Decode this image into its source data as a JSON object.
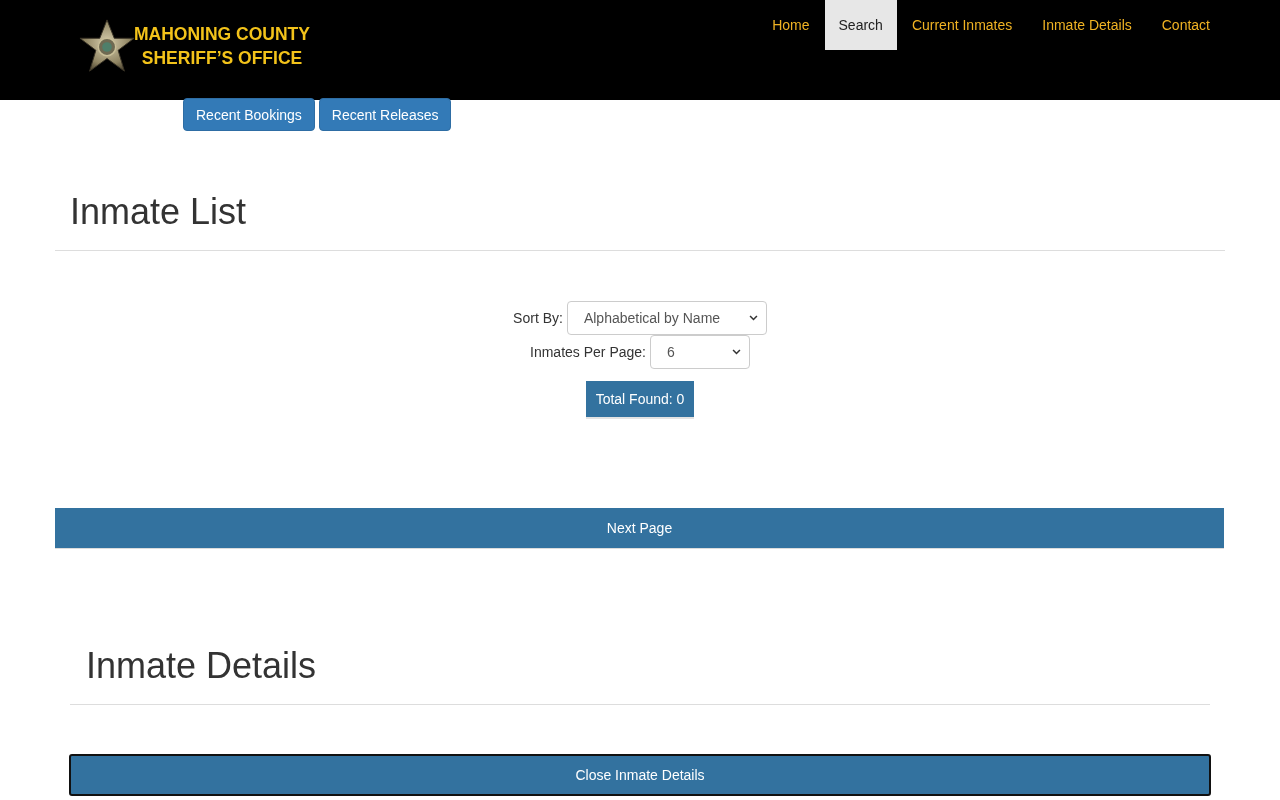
{
  "header": {
    "logo_lines": [
      "MAHONING COUNTY",
      "SHERIFF’S OFFICE"
    ]
  },
  "nav": [
    {
      "label": "Home",
      "selected": false
    },
    {
      "label": "Search",
      "selected": true
    },
    {
      "label": "Current Inmates",
      "selected": false
    },
    {
      "label": "Inmate Details",
      "selected": false
    },
    {
      "label": "Contact",
      "selected": false
    }
  ],
  "quick_links": [
    "Recent Bookings",
    "Recent Releases"
  ],
  "inmate_list": {
    "title": "Inmate List",
    "sort_by": {
      "label": "Sort By:",
      "value": "Alphabetical by Name"
    },
    "per_page": {
      "label": "Inmates Per Page:",
      "value": "6"
    },
    "total_found": "Total Found: 0",
    "next_button": "Next Page"
  },
  "inmate_details": {
    "title": "Inmate Details",
    "close_button": "Close Inmate Details"
  }
}
